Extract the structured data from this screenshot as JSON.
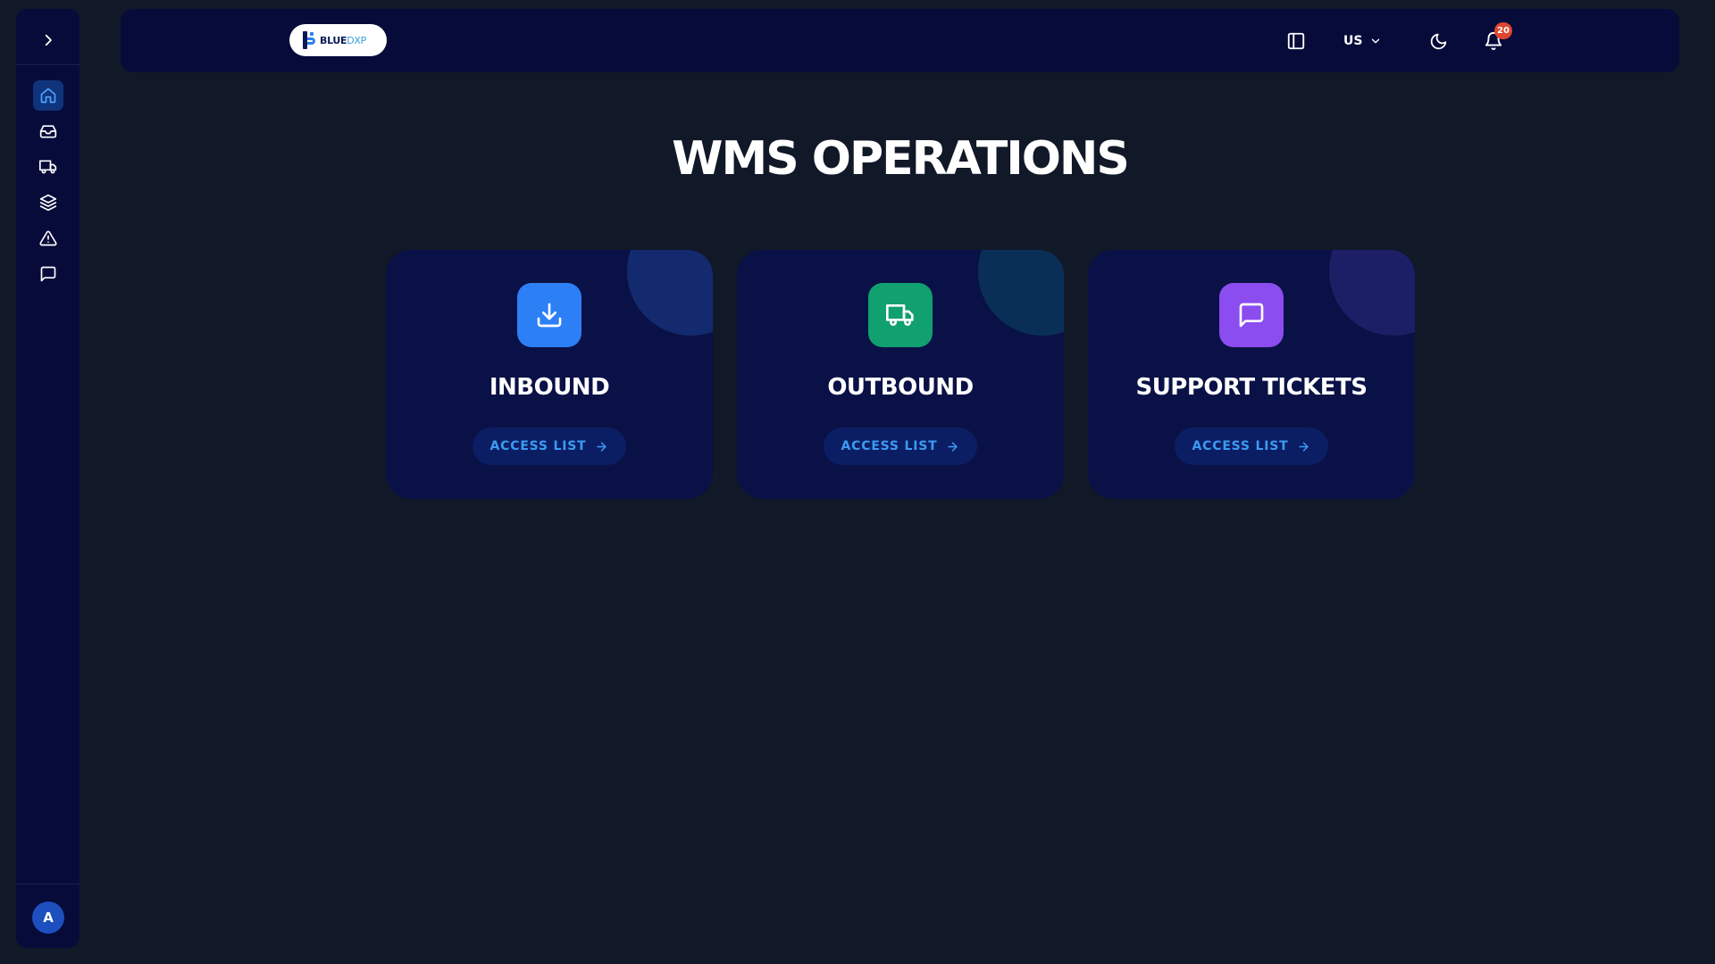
{
  "sidebar": {
    "toggle_icon": "chevron-right-icon",
    "items": [
      {
        "id": "home",
        "icon": "home-icon",
        "active": true
      },
      {
        "id": "inbound",
        "icon": "inbox-icon",
        "active": false
      },
      {
        "id": "outbound",
        "icon": "truck-icon",
        "active": false
      },
      {
        "id": "inventory",
        "icon": "layers-icon",
        "active": false
      },
      {
        "id": "alerts",
        "icon": "alert-triangle-icon",
        "active": false
      },
      {
        "id": "support",
        "icon": "message-square-icon",
        "active": false
      }
    ],
    "avatar_initial": "A"
  },
  "topbar": {
    "logo_word_1": "BLUE",
    "logo_word_2": "DXP",
    "language": "US",
    "notification_count": "20"
  },
  "page": {
    "title": "WMS OPERATIONS"
  },
  "cards": [
    {
      "title": "INBOUND",
      "button_label": "ACCESS LIST",
      "icon": "download-icon",
      "icon_color": "#2d7ff6",
      "accent": "#142a6e"
    },
    {
      "title": "OUTBOUND",
      "button_label": "ACCESS LIST",
      "icon": "truck-icon",
      "icon_color": "#11a06f",
      "accent": "#0a2f57"
    },
    {
      "title": "SUPPORT TICKETS",
      "button_label": "ACCESS LIST",
      "icon": "message-square-icon",
      "icon_color": "#8b4cf0",
      "accent": "#1c1f66"
    }
  ],
  "colors": {
    "background": "#111827",
    "panel": "#060b3a",
    "card": "#0a1146",
    "link": "#3b9bf5",
    "badge": "#e0452f"
  }
}
